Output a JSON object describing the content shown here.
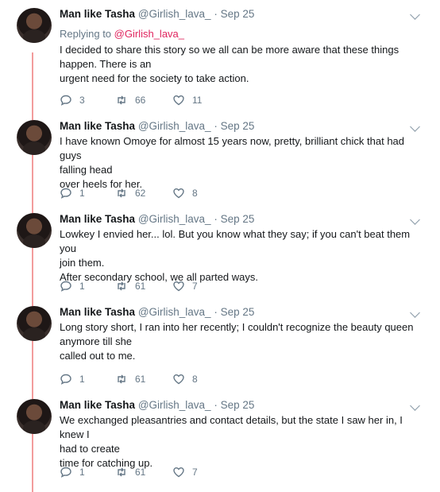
{
  "tweets": [
    {
      "name": "Man like Tasha",
      "handle": "@Girlish_lava_",
      "date": "Sep 25",
      "replying_prefix": "Replying to",
      "replying_to": "@Girlish_lava_",
      "lines": [
        "I decided to share this story so we all can be more aware that these things",
        "happen. There is an",
        "urgent need for the society to take action."
      ],
      "replies": "3",
      "retweets": "66",
      "likes": "11"
    },
    {
      "name": "Man like Tasha",
      "handle": "@Girlish_lava_",
      "date": "Sep 25",
      "lines": [
        "I have known Omoye for almost 15 years now, pretty, brilliant chick that had guys",
        "falling head",
        "over heels for her."
      ],
      "replies": "1",
      "retweets": "62",
      "likes": "8"
    },
    {
      "name": "Man like Tasha",
      "handle": "@Girlish_lava_",
      "date": "Sep 25",
      "lines": [
        "Lowkey I envied her... lol. But you know what they say; if you can't beat them you",
        "join them.",
        "After secondary school, we all parted ways."
      ],
      "replies": "1",
      "retweets": "61",
      "likes": "7"
    },
    {
      "name": "Man like Tasha",
      "handle": "@Girlish_lava_",
      "date": "Sep 25",
      "lines": [
        "Long story short, I ran into her recently; I couldn't recognize the beauty queen",
        "anymore till she",
        "called out to me."
      ],
      "replies": "1",
      "retweets": "61",
      "likes": "8"
    },
    {
      "name": "Man like Tasha",
      "handle": "@Girlish_lava_",
      "date": "Sep 25",
      "lines": [
        "We exchanged pleasantries  and contact details, but the state I saw her in, I knew I",
        "had to create",
        "time for catching up."
      ],
      "replies": "1",
      "retweets": "61",
      "likes": "7"
    }
  ],
  "icons": {
    "reply": "reply-icon",
    "retweet": "retweet-icon",
    "like": "heart-icon",
    "menu": "chevron-down-icon"
  },
  "colors": {
    "link": "#e0245e",
    "thread_line": "#f29c9c",
    "muted": "#657786"
  }
}
